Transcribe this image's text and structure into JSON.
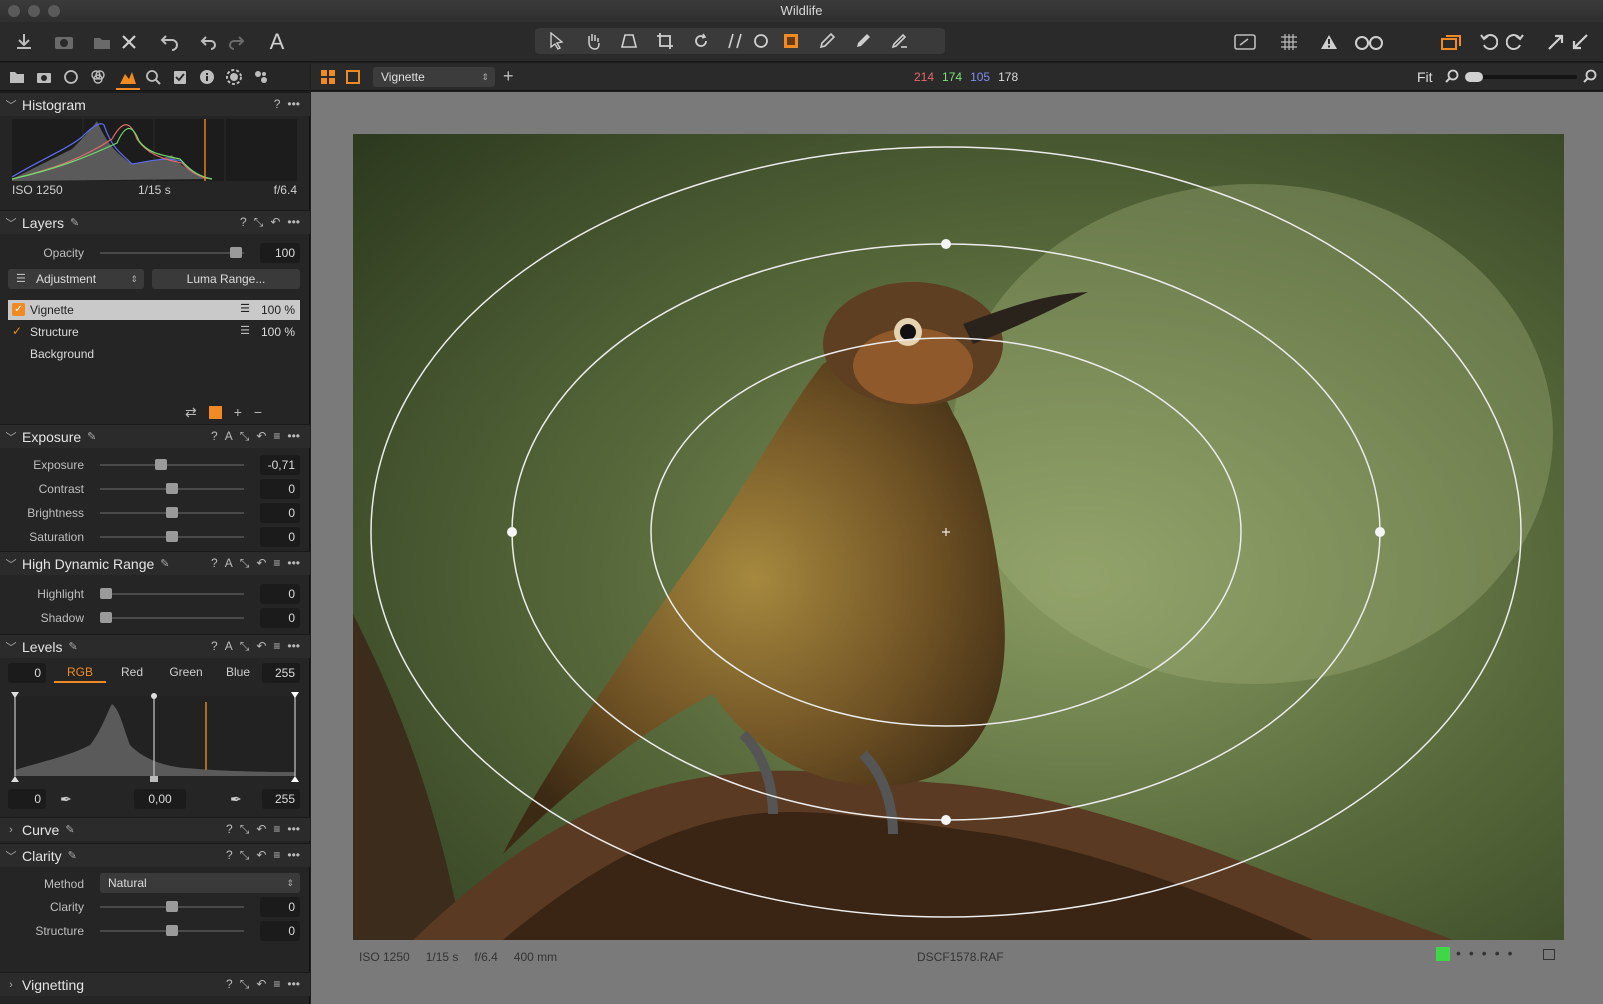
{
  "window": {
    "title": "Wildlife"
  },
  "viewer_bar": {
    "tool_select": "Vignette",
    "rgb_r": "214",
    "rgb_g": "174",
    "rgb_b": "105",
    "rgb_l": "178",
    "zoom_label": "Fit"
  },
  "histogram": {
    "title": "Histogram",
    "iso": "ISO 1250",
    "shutter": "1/15 s",
    "aperture": "f/6.4",
    "help": "?"
  },
  "layers": {
    "title": "Layers",
    "opacity_label": "Opacity",
    "opacity_value": "100",
    "adjustment_label": "Adjustment",
    "luma_label": "Luma Range...",
    "items": [
      {
        "name": "Vignette",
        "opacity": "100 %"
      },
      {
        "name": "Structure",
        "opacity": "100 %"
      },
      {
        "name": "Background"
      }
    ]
  },
  "exposure": {
    "title": "Exposure",
    "rows": [
      {
        "label": "Exposure",
        "value": "-0,71",
        "level": 0.42
      },
      {
        "label": "Contrast",
        "value": "0",
        "level": 0.5
      },
      {
        "label": "Brightness",
        "value": "0",
        "level": 0.5
      },
      {
        "label": "Saturation",
        "value": "0",
        "level": 0.5
      }
    ]
  },
  "hdr": {
    "title": "High Dynamic Range",
    "rows": [
      {
        "label": "Highlight",
        "value": "0",
        "level": 0
      },
      {
        "label": "Shadow",
        "value": "0",
        "level": 0
      }
    ]
  },
  "levels": {
    "title": "Levels",
    "low": "0",
    "high": "255",
    "tabs": [
      "RGB",
      "Red",
      "Green",
      "Blue"
    ],
    "out_low": "0",
    "mid": "0,00",
    "out_high": "255"
  },
  "curve": {
    "title": "Curve"
  },
  "clarity": {
    "title": "Clarity",
    "method_label": "Method",
    "method_value": "Natural",
    "rows": [
      {
        "label": "Clarity",
        "value": "0",
        "level": 0.5
      },
      {
        "label": "Structure",
        "value": "0",
        "level": 0.5
      }
    ]
  },
  "vignetting": {
    "title": "Vignetting"
  },
  "status": {
    "iso": "ISO 1250",
    "shutter": "1/15 s",
    "aperture": "f/6.4",
    "focal": "400 mm",
    "filename": "DSCF1578.RAF"
  },
  "icons": [
    "import-icon",
    "camera-icon",
    "export-icon",
    "delete-icon",
    "undo-icon",
    "redo-icon",
    "text-icon",
    "select-icon",
    "pan-icon",
    "keystone-icon",
    "crop-icon",
    "rotate-icon",
    "straighten-icon",
    "circle-icon",
    "mask-icon",
    "brush-icon",
    "eraser-icon",
    "gradient-icon"
  ],
  "colors": {
    "accent": "#f08a24",
    "r": "#e8686a",
    "g": "#7ee07a",
    "b": "#7f8ff0"
  }
}
